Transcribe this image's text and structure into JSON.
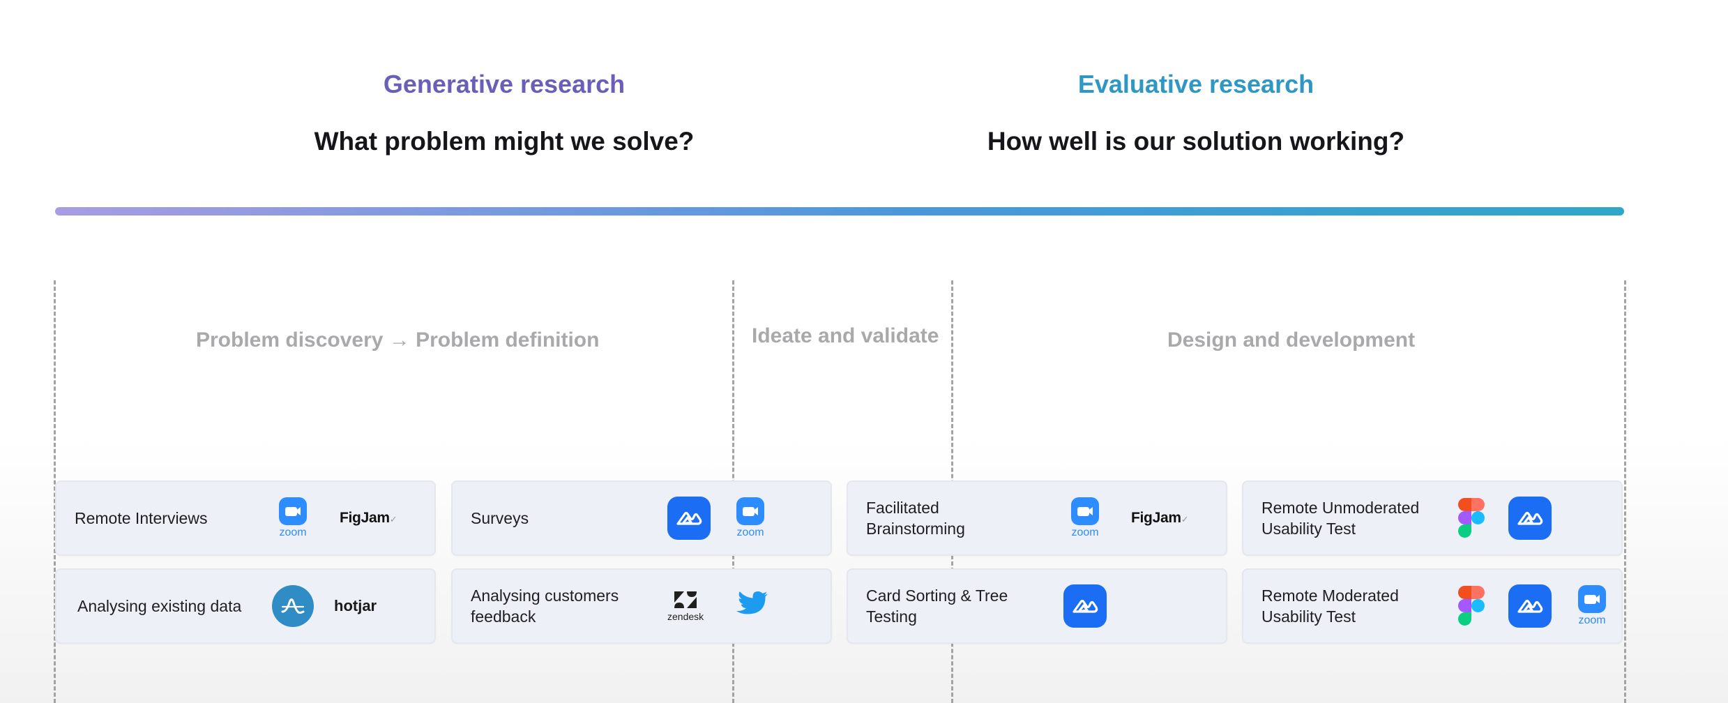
{
  "generative": {
    "title": "Generative research",
    "question": "What problem might we solve?"
  },
  "evaluative": {
    "title": "Evaluative research",
    "question": "How well is our solution working?"
  },
  "phases": {
    "discovery": "Problem discovery → Problem definition",
    "ideate": "Ideate and validate",
    "design": "Design and development"
  },
  "methods": {
    "remote_interviews": {
      "label": "Remote Interviews",
      "tools": [
        "zoom-icon",
        "figjam-logo"
      ]
    },
    "surveys": {
      "label": "Surveys",
      "tools": [
        "maze-icon",
        "zoom-icon"
      ]
    },
    "facilitated_brainstorming": {
      "label": "Facilitated\nBrainstorming",
      "tools": [
        "zoom-icon",
        "figjam-logo"
      ]
    },
    "remote_unmoderated": {
      "label": "Remote Unmoderated\nUsability Test",
      "tools": [
        "figma-icon",
        "maze-icon"
      ]
    },
    "analysing_existing_data": {
      "label": "Analysing existing data",
      "tools": [
        "amplitude-icon",
        "hotjar-logo"
      ]
    },
    "analysing_feedback": {
      "label": "Analysing customers\nfeedback",
      "tools": [
        "zendesk-icon",
        "twitter-icon"
      ]
    },
    "card_sorting": {
      "label": "Card Sorting & Tree\nTesting",
      "tools": [
        "maze-icon"
      ]
    },
    "remote_moderated": {
      "label": "Remote Moderated\nUsability Test",
      "tools": [
        "figma-icon",
        "maze-icon",
        "zoom-icon"
      ]
    }
  },
  "logos": {
    "zoom_word": "zoom",
    "figjam_word": "FigJam",
    "hotjar_word": "hotjar",
    "zendesk_word": "zendesk"
  },
  "colors": {
    "generative_accent": "#6a5fb8",
    "evaluative_accent": "#2f97c4",
    "zoom": "#2d8cff",
    "maze": "#1b6ef3",
    "twitter": "#1d9bf0"
  }
}
